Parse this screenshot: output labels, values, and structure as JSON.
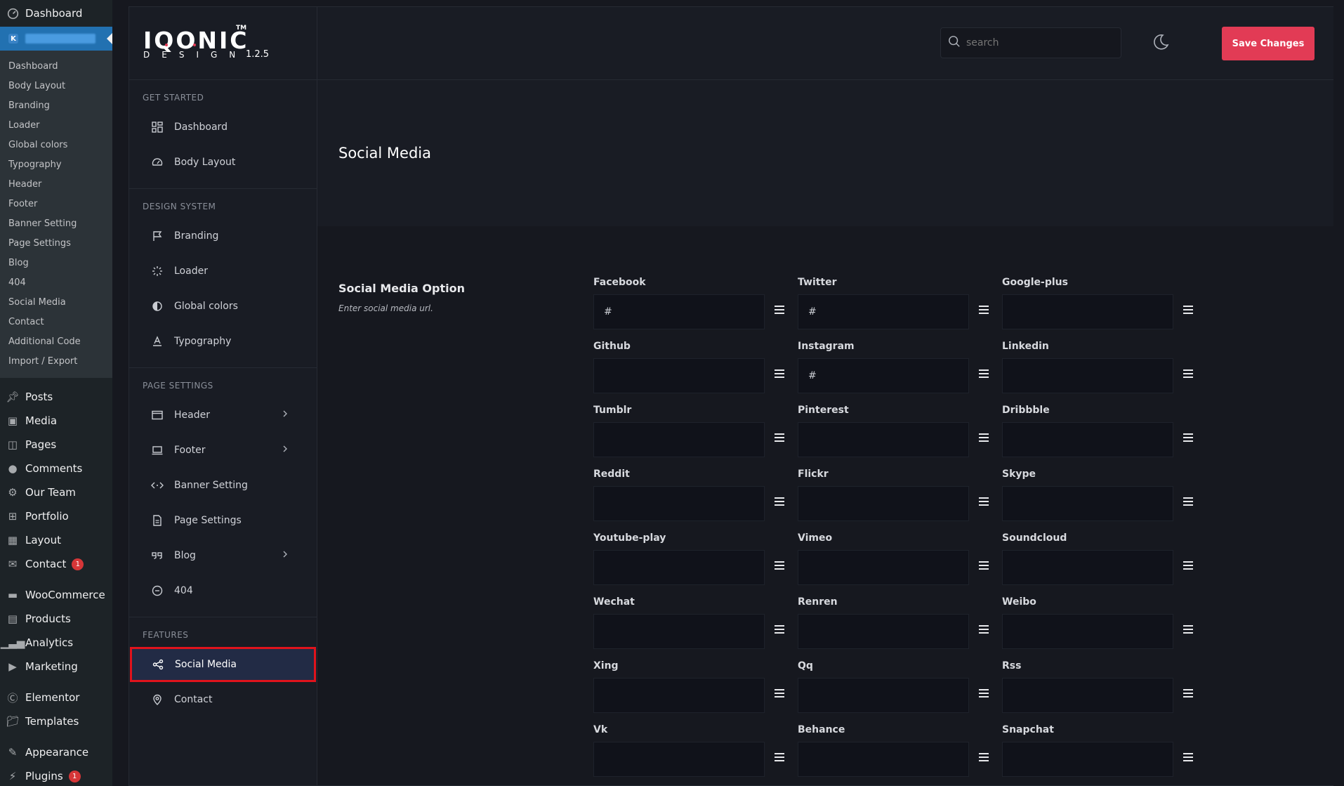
{
  "wp_sidebar": {
    "top_item": "Dashboard",
    "current_badge": "K",
    "submenu": [
      "Dashboard",
      "Body Layout",
      "Branding",
      "Loader",
      "Global colors",
      "Typography",
      "Header",
      "Footer",
      "Banner Setting",
      "Page Settings",
      "Blog",
      "404",
      "Social Media",
      "Contact",
      "Additional Code",
      "Import / Export"
    ],
    "menu": [
      {
        "label": "Posts",
        "icon": "pin-icon"
      },
      {
        "label": "Media",
        "icon": "media-icon"
      },
      {
        "label": "Pages",
        "icon": "pages-icon"
      },
      {
        "label": "Comments",
        "icon": "comments-icon"
      },
      {
        "label": "Our Team",
        "icon": "team-icon"
      },
      {
        "label": "Portfolio",
        "icon": "portfolio-icon"
      },
      {
        "label": "Layout",
        "icon": "layout-icon"
      },
      {
        "label": "Contact",
        "icon": "mail-icon",
        "badge": "1"
      },
      {
        "label": "WooCommerce",
        "icon": "woo-icon"
      },
      {
        "label": "Products",
        "icon": "products-icon"
      },
      {
        "label": "Analytics",
        "icon": "analytics-icon"
      },
      {
        "label": "Marketing",
        "icon": "megaphone-icon"
      },
      {
        "label": "Elementor",
        "icon": "elementor-icon"
      },
      {
        "label": "Templates",
        "icon": "folder-icon"
      },
      {
        "label": "Appearance",
        "icon": "brush-icon"
      },
      {
        "label": "Plugins",
        "icon": "plugin-icon",
        "badge": "1"
      }
    ]
  },
  "brand": {
    "logo": "IQONIC",
    "tm": "TM",
    "sub": "DESIGN",
    "version": "1.2.5"
  },
  "topbar": {
    "search_placeholder": "search",
    "save_label": "Save Changes"
  },
  "nav": {
    "get_started": {
      "heading": "GET STARTED",
      "items": [
        "Dashboard",
        "Body Layout"
      ]
    },
    "design_system": {
      "heading": "DESIGN SYSTEM",
      "items": [
        "Branding",
        "Loader",
        "Global colors",
        "Typography"
      ]
    },
    "page_settings": {
      "heading": "PAGE SETTINGS",
      "items": [
        "Header",
        "Footer",
        "Banner Setting",
        "Page Settings",
        "Blog",
        "404"
      ]
    },
    "features": {
      "heading": "FEATURES",
      "items": [
        "Social Media",
        "Contact"
      ]
    }
  },
  "content": {
    "page_title": "Social Media",
    "section_label": "Social Media Option",
    "section_desc": "Enter social media url.",
    "fields": [
      {
        "label": "Facebook",
        "value": "#"
      },
      {
        "label": "Twitter",
        "value": "#"
      },
      {
        "label": "Google-plus",
        "value": ""
      },
      {
        "label": "Github",
        "value": ""
      },
      {
        "label": "Instagram",
        "value": "#"
      },
      {
        "label": "Linkedin",
        "value": ""
      },
      {
        "label": "Tumblr",
        "value": ""
      },
      {
        "label": "Pinterest",
        "value": ""
      },
      {
        "label": "Dribbble",
        "value": ""
      },
      {
        "label": "Reddit",
        "value": ""
      },
      {
        "label": "Flickr",
        "value": ""
      },
      {
        "label": "Skype",
        "value": ""
      },
      {
        "label": "Youtube-play",
        "value": ""
      },
      {
        "label": "Vimeo",
        "value": ""
      },
      {
        "label": "Soundcloud",
        "value": ""
      },
      {
        "label": "Wechat",
        "value": ""
      },
      {
        "label": "Renren",
        "value": ""
      },
      {
        "label": "Weibo",
        "value": ""
      },
      {
        "label": "Xing",
        "value": ""
      },
      {
        "label": "Qq",
        "value": ""
      },
      {
        "label": "Rss",
        "value": ""
      },
      {
        "label": "Vk",
        "value": ""
      },
      {
        "label": "Behance",
        "value": ""
      },
      {
        "label": "Snapchat",
        "value": ""
      }
    ]
  },
  "colors": {
    "accent": "#e23b55",
    "wp_blue": "#2271b1",
    "active_outline": "#e0131c"
  }
}
